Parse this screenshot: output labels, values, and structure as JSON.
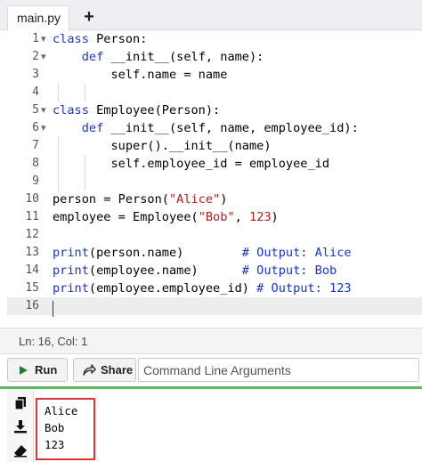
{
  "tabs": {
    "active_label": "main.py",
    "add_label": "+"
  },
  "editor": {
    "lines": [
      {
        "n": "1",
        "fold": "▾",
        "code": [
          {
            "t": "class",
            "c": "kw"
          },
          {
            "t": " Person:"
          }
        ]
      },
      {
        "n": "2",
        "fold": "▾",
        "code": [
          {
            "t": "    "
          },
          {
            "t": "def",
            "c": "kw"
          },
          {
            "t": " __init__(self, name):"
          }
        ]
      },
      {
        "n": "3",
        "fold": "",
        "code": [
          {
            "t": "        self.name = name"
          }
        ]
      },
      {
        "n": "4",
        "fold": "",
        "code": []
      },
      {
        "n": "5",
        "fold": "▾",
        "code": [
          {
            "t": "class",
            "c": "kw"
          },
          {
            "t": " Employee(Person):"
          }
        ]
      },
      {
        "n": "6",
        "fold": "▾",
        "code": [
          {
            "t": "    "
          },
          {
            "t": "def",
            "c": "kw"
          },
          {
            "t": " __init__(self, name, employee_id):"
          }
        ]
      },
      {
        "n": "7",
        "fold": "",
        "code": [
          {
            "t": "        super().__init__(name)"
          }
        ]
      },
      {
        "n": "8",
        "fold": "",
        "code": [
          {
            "t": "        self.employee_id = employee_id"
          }
        ]
      },
      {
        "n": "9",
        "fold": "",
        "code": []
      },
      {
        "n": "10",
        "fold": "",
        "code": [
          {
            "t": "person = Person("
          },
          {
            "t": "\"Alice\"",
            "c": "str"
          },
          {
            "t": ")"
          }
        ]
      },
      {
        "n": "11",
        "fold": "",
        "code": [
          {
            "t": "employee = Employee("
          },
          {
            "t": "\"Bob\"",
            "c": "str"
          },
          {
            "t": ", "
          },
          {
            "t": "123",
            "c": "str"
          },
          {
            "t": ")"
          }
        ]
      },
      {
        "n": "12",
        "fold": "",
        "code": []
      },
      {
        "n": "13",
        "fold": "",
        "code": [
          {
            "t": "print",
            "c": "kw"
          },
          {
            "t": "(person.name)        "
          },
          {
            "t": "# Output: Alice",
            "c": "cm"
          }
        ]
      },
      {
        "n": "14",
        "fold": "",
        "code": [
          {
            "t": "print",
            "c": "kw"
          },
          {
            "t": "(employee.name)      "
          },
          {
            "t": "# Output: Bob",
            "c": "cm"
          }
        ]
      },
      {
        "n": "15",
        "fold": "",
        "code": [
          {
            "t": "print",
            "c": "kw"
          },
          {
            "t": "(employee.employee_id) "
          },
          {
            "t": "# Output: 123",
            "c": "cm"
          }
        ]
      },
      {
        "n": "16",
        "fold": "",
        "code": []
      }
    ],
    "active_line": "16"
  },
  "status": {
    "text": "Ln: 16,  Col: 1"
  },
  "toolbar": {
    "run_label": "Run",
    "share_label": "Share",
    "args_placeholder": "Command Line Arguments",
    "run_color": "#1e7e34"
  },
  "output": {
    "lines": [
      "Alice",
      "Bob",
      "123"
    ],
    "highlight_color": "#e03535",
    "accent_color": "#5cb85c",
    "sidebar_icons": [
      "copy-icon",
      "download-icon",
      "eraser-icon"
    ]
  }
}
